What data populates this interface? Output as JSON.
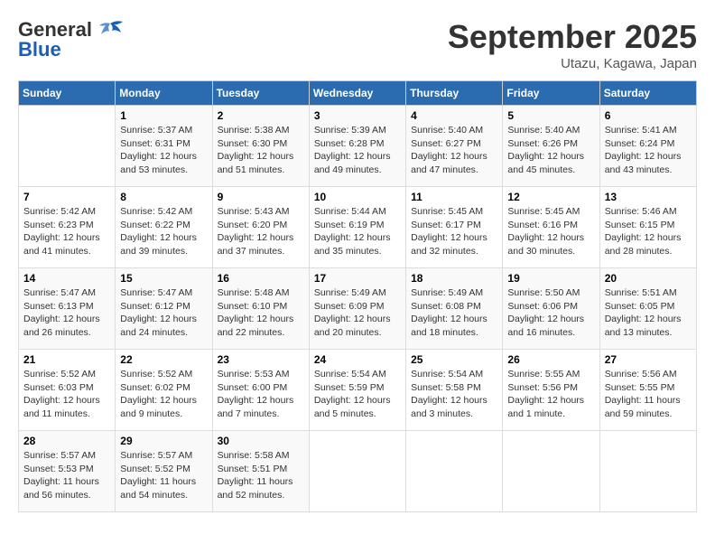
{
  "header": {
    "logo_general": "General",
    "logo_blue": "Blue",
    "month": "September 2025",
    "location": "Utazu, Kagawa, Japan"
  },
  "days_of_week": [
    "Sunday",
    "Monday",
    "Tuesday",
    "Wednesday",
    "Thursday",
    "Friday",
    "Saturday"
  ],
  "weeks": [
    [
      {
        "day": "",
        "info": ""
      },
      {
        "day": "1",
        "info": "Sunrise: 5:37 AM\nSunset: 6:31 PM\nDaylight: 12 hours\nand 53 minutes."
      },
      {
        "day": "2",
        "info": "Sunrise: 5:38 AM\nSunset: 6:30 PM\nDaylight: 12 hours\nand 51 minutes."
      },
      {
        "day": "3",
        "info": "Sunrise: 5:39 AM\nSunset: 6:28 PM\nDaylight: 12 hours\nand 49 minutes."
      },
      {
        "day": "4",
        "info": "Sunrise: 5:40 AM\nSunset: 6:27 PM\nDaylight: 12 hours\nand 47 minutes."
      },
      {
        "day": "5",
        "info": "Sunrise: 5:40 AM\nSunset: 6:26 PM\nDaylight: 12 hours\nand 45 minutes."
      },
      {
        "day": "6",
        "info": "Sunrise: 5:41 AM\nSunset: 6:24 PM\nDaylight: 12 hours\nand 43 minutes."
      }
    ],
    [
      {
        "day": "7",
        "info": "Sunrise: 5:42 AM\nSunset: 6:23 PM\nDaylight: 12 hours\nand 41 minutes."
      },
      {
        "day": "8",
        "info": "Sunrise: 5:42 AM\nSunset: 6:22 PM\nDaylight: 12 hours\nand 39 minutes."
      },
      {
        "day": "9",
        "info": "Sunrise: 5:43 AM\nSunset: 6:20 PM\nDaylight: 12 hours\nand 37 minutes."
      },
      {
        "day": "10",
        "info": "Sunrise: 5:44 AM\nSunset: 6:19 PM\nDaylight: 12 hours\nand 35 minutes."
      },
      {
        "day": "11",
        "info": "Sunrise: 5:45 AM\nSunset: 6:17 PM\nDaylight: 12 hours\nand 32 minutes."
      },
      {
        "day": "12",
        "info": "Sunrise: 5:45 AM\nSunset: 6:16 PM\nDaylight: 12 hours\nand 30 minutes."
      },
      {
        "day": "13",
        "info": "Sunrise: 5:46 AM\nSunset: 6:15 PM\nDaylight: 12 hours\nand 28 minutes."
      }
    ],
    [
      {
        "day": "14",
        "info": "Sunrise: 5:47 AM\nSunset: 6:13 PM\nDaylight: 12 hours\nand 26 minutes."
      },
      {
        "day": "15",
        "info": "Sunrise: 5:47 AM\nSunset: 6:12 PM\nDaylight: 12 hours\nand 24 minutes."
      },
      {
        "day": "16",
        "info": "Sunrise: 5:48 AM\nSunset: 6:10 PM\nDaylight: 12 hours\nand 22 minutes."
      },
      {
        "day": "17",
        "info": "Sunrise: 5:49 AM\nSunset: 6:09 PM\nDaylight: 12 hours\nand 20 minutes."
      },
      {
        "day": "18",
        "info": "Sunrise: 5:49 AM\nSunset: 6:08 PM\nDaylight: 12 hours\nand 18 minutes."
      },
      {
        "day": "19",
        "info": "Sunrise: 5:50 AM\nSunset: 6:06 PM\nDaylight: 12 hours\nand 16 minutes."
      },
      {
        "day": "20",
        "info": "Sunrise: 5:51 AM\nSunset: 6:05 PM\nDaylight: 12 hours\nand 13 minutes."
      }
    ],
    [
      {
        "day": "21",
        "info": "Sunrise: 5:52 AM\nSunset: 6:03 PM\nDaylight: 12 hours\nand 11 minutes."
      },
      {
        "day": "22",
        "info": "Sunrise: 5:52 AM\nSunset: 6:02 PM\nDaylight: 12 hours\nand 9 minutes."
      },
      {
        "day": "23",
        "info": "Sunrise: 5:53 AM\nSunset: 6:00 PM\nDaylight: 12 hours\nand 7 minutes."
      },
      {
        "day": "24",
        "info": "Sunrise: 5:54 AM\nSunset: 5:59 PM\nDaylight: 12 hours\nand 5 minutes."
      },
      {
        "day": "25",
        "info": "Sunrise: 5:54 AM\nSunset: 5:58 PM\nDaylight: 12 hours\nand 3 minutes."
      },
      {
        "day": "26",
        "info": "Sunrise: 5:55 AM\nSunset: 5:56 PM\nDaylight: 12 hours\nand 1 minute."
      },
      {
        "day": "27",
        "info": "Sunrise: 5:56 AM\nSunset: 5:55 PM\nDaylight: 11 hours\nand 59 minutes."
      }
    ],
    [
      {
        "day": "28",
        "info": "Sunrise: 5:57 AM\nSunset: 5:53 PM\nDaylight: 11 hours\nand 56 minutes."
      },
      {
        "day": "29",
        "info": "Sunrise: 5:57 AM\nSunset: 5:52 PM\nDaylight: 11 hours\nand 54 minutes."
      },
      {
        "day": "30",
        "info": "Sunrise: 5:58 AM\nSunset: 5:51 PM\nDaylight: 11 hours\nand 52 minutes."
      },
      {
        "day": "",
        "info": ""
      },
      {
        "day": "",
        "info": ""
      },
      {
        "day": "",
        "info": ""
      },
      {
        "day": "",
        "info": ""
      }
    ]
  ]
}
